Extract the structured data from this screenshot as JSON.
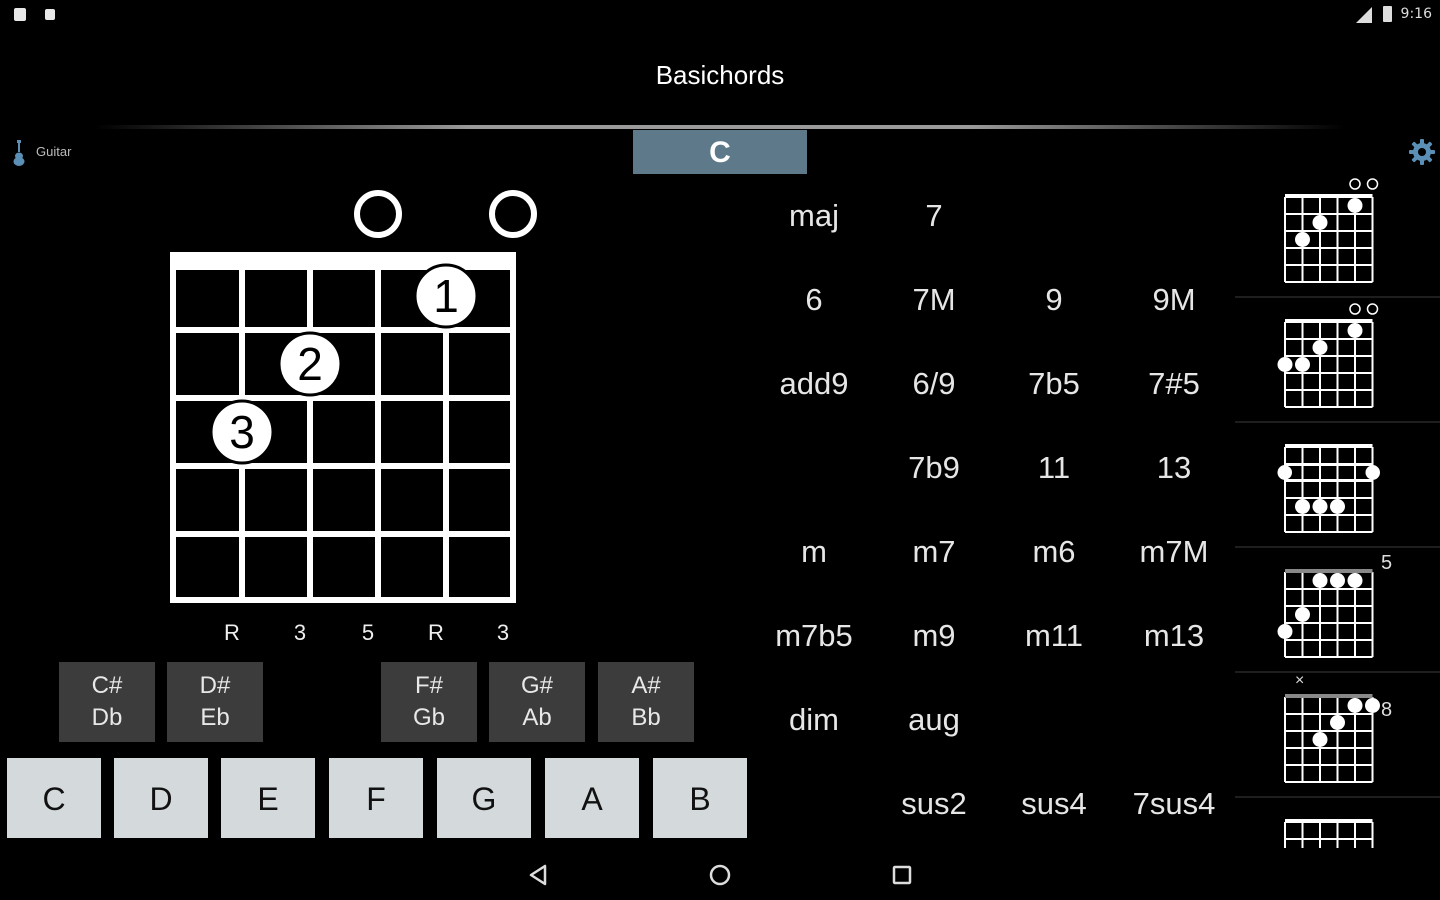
{
  "status_bar": {
    "time": "9:16"
  },
  "app": {
    "title": "Basichords"
  },
  "instrument": {
    "label": "Guitar"
  },
  "root_tab": {
    "label": "C"
  },
  "fretboard": {
    "open_strings": [
      3,
      5
    ],
    "fingers": [
      {
        "label": "1",
        "string": 4,
        "fret": 1
      },
      {
        "label": "2",
        "string": 2,
        "fret": 2
      },
      {
        "label": "3",
        "string": 1,
        "fret": 3
      }
    ],
    "tones": [
      "R",
      "3",
      "5",
      "R",
      "3"
    ]
  },
  "keys": {
    "sharps": [
      {
        "top": "C#",
        "bottom": "Db"
      },
      {
        "top": "D#",
        "bottom": "Eb"
      },
      {
        "top": "F#",
        "bottom": "Gb"
      },
      {
        "top": "G#",
        "bottom": "Ab"
      },
      {
        "top": "A#",
        "bottom": "Bb"
      }
    ],
    "naturals": [
      "C",
      "D",
      "E",
      "F",
      "G",
      "A",
      "B"
    ]
  },
  "chord_types": {
    "rows": [
      [
        "maj",
        "7",
        "",
        ""
      ],
      [
        "6",
        "7M",
        "9",
        "9M"
      ],
      [
        "add9",
        "6/9",
        "7b5",
        "7#5"
      ],
      [
        "",
        "7b9",
        "11",
        "13"
      ],
      [
        "m",
        "m7",
        "m6",
        "m7M"
      ],
      [
        "m7b5",
        "m9",
        "m11",
        "m13"
      ],
      [
        "dim",
        "aug",
        "",
        ""
      ],
      [
        "",
        "sus2",
        "sus4",
        "7sus4"
      ]
    ]
  },
  "diagrams": [
    {
      "position": "",
      "muted": ""
    },
    {
      "position": "",
      "muted": ""
    },
    {
      "position": "",
      "muted": ""
    },
    {
      "position": "5",
      "muted": ""
    },
    {
      "position": "8",
      "muted": "×"
    },
    {
      "position": "",
      "muted": ""
    }
  ],
  "colors": {
    "accent_tab": "#5e7a8a",
    "sharp_key": "#3c3c3c",
    "natural_key": "#d4d9db",
    "icon_blue": "#5b8fb5"
  }
}
